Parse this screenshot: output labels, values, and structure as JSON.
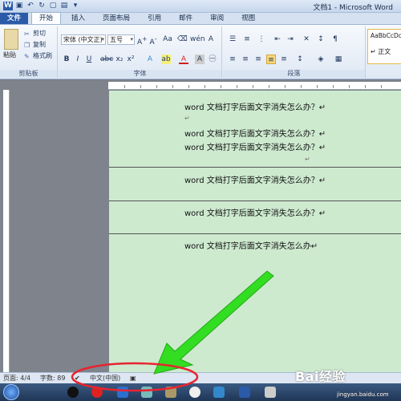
{
  "window": {
    "title": "文档1 - Microsoft Word",
    "quick_access_icons": [
      "word-app-icon",
      "save-icon",
      "undo-icon",
      "redo-icon",
      "open-icon",
      "customize-icon"
    ]
  },
  "tabs": [
    {
      "label": "文件",
      "active": false
    },
    {
      "label": "开始",
      "active": true
    },
    {
      "label": "插入",
      "active": false
    },
    {
      "label": "页面布局",
      "active": false
    },
    {
      "label": "引用",
      "active": false
    },
    {
      "label": "邮件",
      "active": false
    },
    {
      "label": "审阅",
      "active": false
    },
    {
      "label": "视图",
      "active": false
    }
  ],
  "ribbon": {
    "clipboard": {
      "paste_label": "粘贴",
      "cut_label": "剪切",
      "copy_label": "复制",
      "format_painter_label": "格式刷",
      "group_label": "剪贴板"
    },
    "font": {
      "font_name": "宋体 (中文正)",
      "font_size": "五号",
      "group_label": "字体"
    },
    "paragraph": {
      "group_label": "段落"
    },
    "styles": {
      "preview_1": "AaBbCcDc",
      "preview_2": "↵ 正文"
    }
  },
  "document": {
    "lines": [
      "word 文档打字后面文字消失怎么办？↵",
      "word 文档打字后面文字消失怎么办？↵",
      "word 文档打字后面文字消失怎么办？↵",
      "word 文档打字后面文字消失怎么办？↵",
      "word 文档打字后面文字消失怎么办？↵",
      "word 文档打字后面文字消失怎么办↵"
    ],
    "empty_marks": [
      "↵",
      "↵"
    ],
    "page_color": "#cdeacf"
  },
  "statusbar": {
    "page": "页面: 4/4",
    "words": "字数: 89",
    "language": "中文(中国)"
  },
  "watermark": {
    "brand": "Bai经验",
    "url": "jingyan.baidu.com"
  },
  "colors": {
    "arrow": "#33dd22",
    "highlight_ellipse": "#e8242f"
  }
}
